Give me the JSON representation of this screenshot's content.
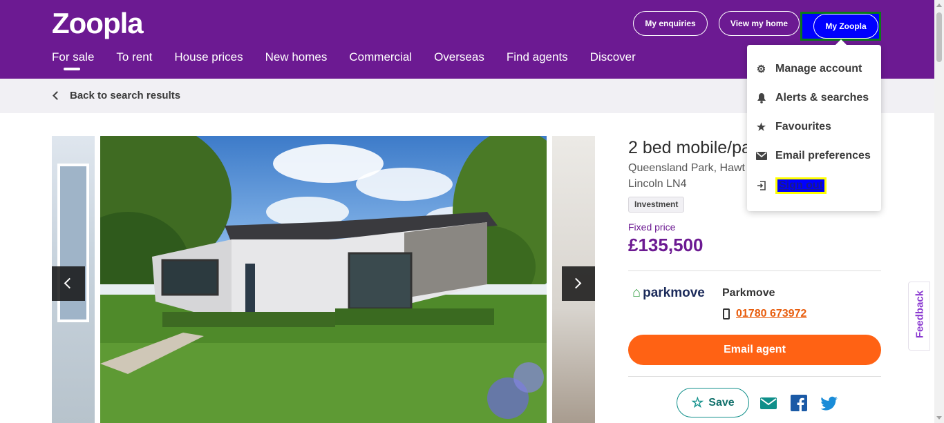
{
  "header": {
    "logo": "Zoopla",
    "nav": [
      {
        "label": "For sale",
        "active": true
      },
      {
        "label": "To rent"
      },
      {
        "label": "House prices"
      },
      {
        "label": "New homes"
      },
      {
        "label": "Commercial"
      },
      {
        "label": "Overseas"
      },
      {
        "label": "Find agents"
      },
      {
        "label": "Discover"
      }
    ],
    "enquiries_label": "My enquiries",
    "view_home_label": "View my home",
    "my_zoopla_label": "My Zoopla"
  },
  "menu": {
    "items": [
      {
        "label": "Manage account",
        "icon": "gear-icon"
      },
      {
        "label": "Alerts & searches",
        "icon": "bell-icon"
      },
      {
        "label": "Favourites",
        "icon": "star-icon"
      },
      {
        "label": "Email preferences",
        "icon": "envelope-icon"
      },
      {
        "label": "Sign out",
        "icon": "sign-out-icon"
      }
    ]
  },
  "subbar": {
    "back_label": "Back to search results"
  },
  "listing": {
    "title": "2 bed mobile/park",
    "address_line1": "Queensland Park, Hawt",
    "address_line2": "Lincoln LN4",
    "tag": "Investment",
    "price_label": "Fixed price",
    "price": "£135,500"
  },
  "agent": {
    "logo_text": "parkmove",
    "name": "Parkmove",
    "phone": "01780 673972",
    "email_label": "Email agent"
  },
  "actions": {
    "save_label": "Save"
  },
  "feedback_label": "Feedback",
  "colors": {
    "brand": "#6c1a92",
    "accent": "#ff6214",
    "teal": "#0f8f8a",
    "highlight": "#0000ff"
  }
}
